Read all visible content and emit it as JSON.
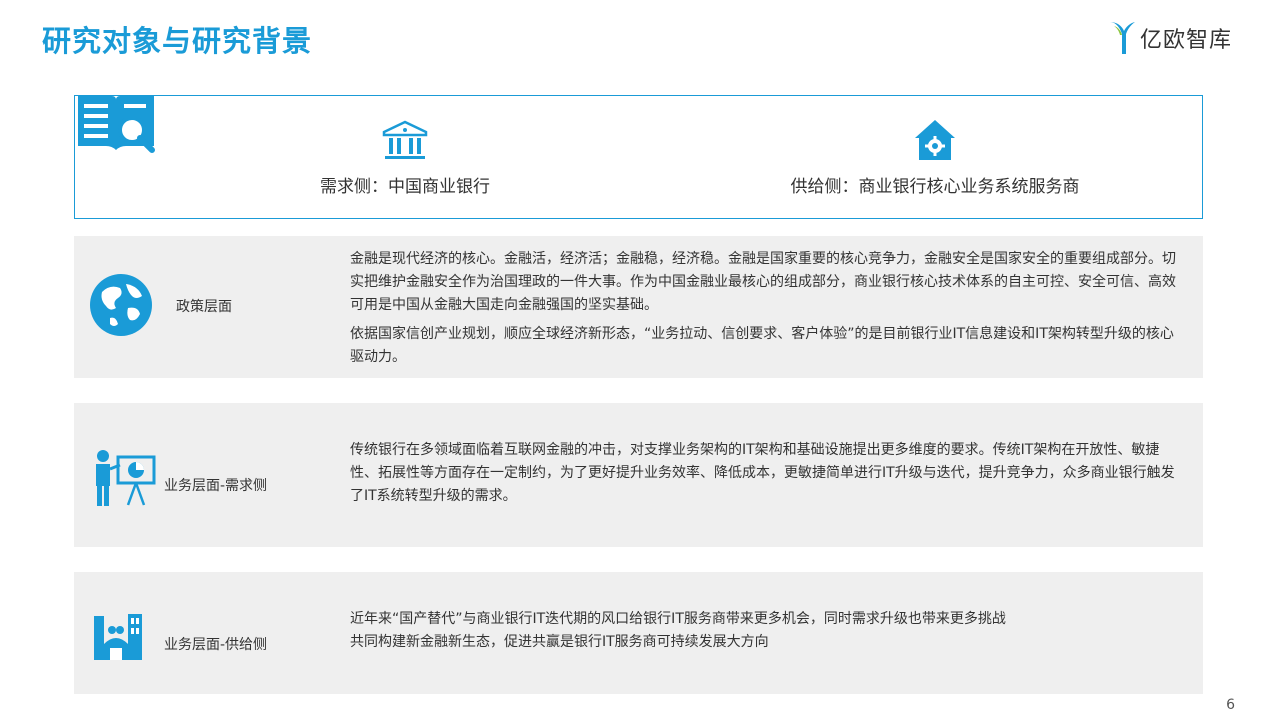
{
  "header": {
    "title": "研究对象与研究背景",
    "logo_text": "亿欧智库",
    "accent_color": "#1a9bd7"
  },
  "sides": {
    "demand": {
      "icon": "bank-icon",
      "label": "需求侧：中国商业银行"
    },
    "supply": {
      "icon": "house-gear-icon",
      "label": "供给侧：商业银行核心业务系统服务商"
    }
  },
  "panels": [
    {
      "icon": "globe-icon",
      "label": "政策层面",
      "paragraphs": [
        "金融是现代经济的核心。金融活，经济活；金融稳，经济稳。金融是国家重要的核心竞争力，金融安全是国家安全的重要组成部分。切实把维护金融安全作为治国理政的一件大事。作为中国金融业最核心的组成部分，商业银行核心技术体系的自主可控、安全可信、高效可用是中国从金融大国走向金融强国的坚实基础。",
        "依据国家信创产业规划，顺应全球经济新形态，“业务拉动、信创要求、客户体验”的是目前银行业IT信息建设和IT架构转型升级的核心驱动力。"
      ]
    },
    {
      "icon": "presenter-chart-icon",
      "label": "业务层面-需求侧",
      "paragraphs": [
        "传统银行在多领域面临着互联网金融的冲击，对支撑业务架构的IT架构和基础设施提出更多维度的要求。传统IT架构在开放性、敏捷性、拓展性等方面存在一定制约，为了更好提升业务效率、降低成本，更敏捷简单进行IT升级与迭代，提升竞争力，众多商业银行触发了IT系统转型升级的需求。"
      ]
    },
    {
      "icon": "factory-icon",
      "label": "业务层面-供给侧",
      "paragraphs": [
        "近年来“国产替代”与商业银行IT迭代期的风口给银行IT服务商带来更多机会，同时需求升级也带来更多挑战",
        "共同构建新金融新生态，促进共赢是银行IT服务商可持续发展大方向"
      ]
    }
  ],
  "page_number": "6"
}
